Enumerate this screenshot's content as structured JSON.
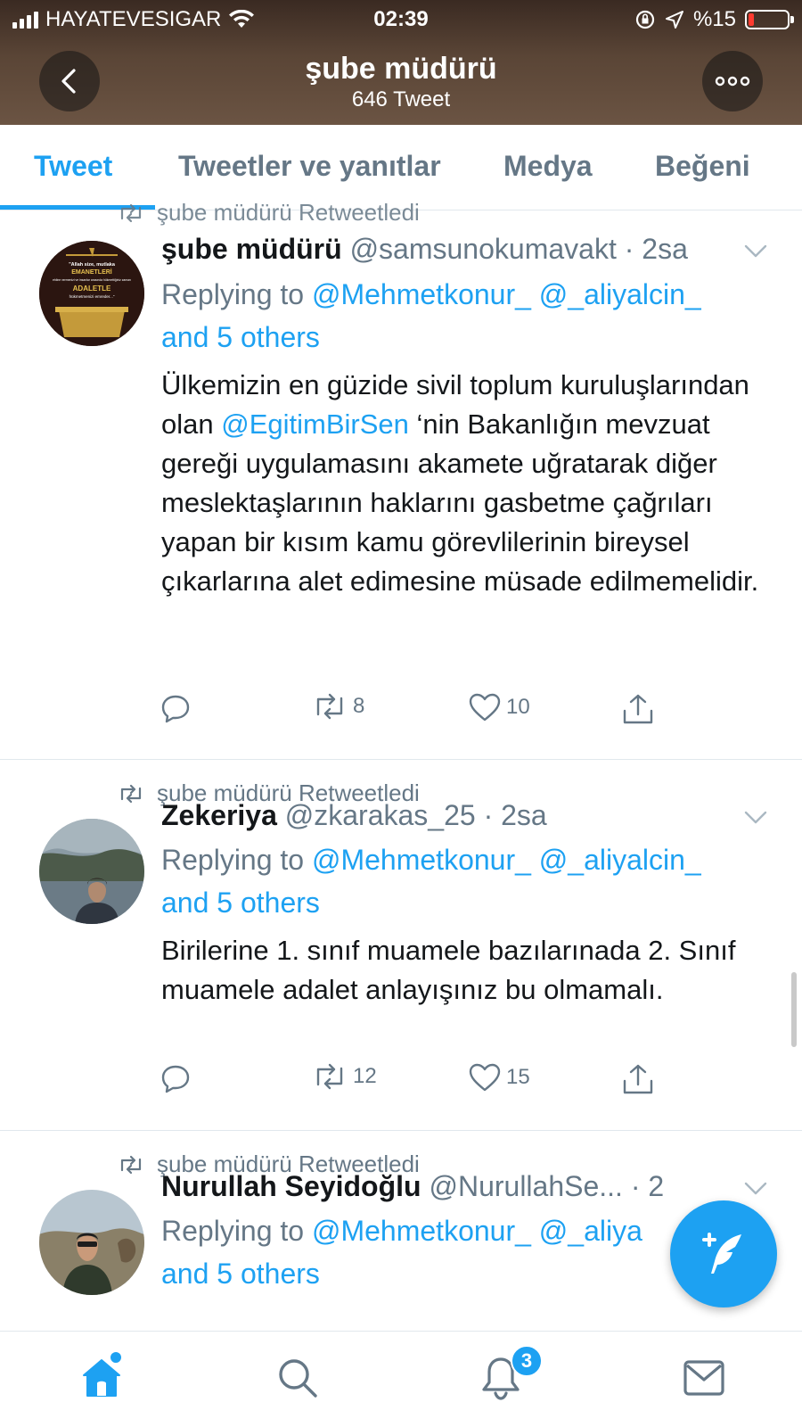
{
  "status_bar": {
    "carrier": "HAYATEVESIGAR",
    "time": "02:39",
    "battery": "%15",
    "battery_level": 0.15,
    "icons": [
      "signal-bars-icon",
      "wifi-icon",
      "orientation-lock-icon",
      "location-arrow-icon",
      "battery-icon"
    ]
  },
  "header": {
    "title": "şube müdürü",
    "subtitle": "646 Tweet",
    "back_icon": "chevron-left-icon",
    "more_icon": "more-dots-icon"
  },
  "tabs": [
    {
      "label": "Tweet",
      "active": true
    },
    {
      "label": "Tweetler ve yanıtlar",
      "active": false
    },
    {
      "label": "Medya",
      "active": false
    },
    {
      "label": "Beğeni",
      "active": false
    }
  ],
  "tweets": [
    {
      "retweet_label": "şube müdürü Retweetledi",
      "name": "şube müdürü",
      "handle": "@samsunokumavakt",
      "time": "2sa",
      "reply_prefix": "Replying to",
      "reply_mention_1": "@Mehmetkonur_",
      "reply_mention_2": "@_aliyalcin_",
      "reply_others": "and 5 others",
      "text_before": "Ülkemizin en güzide sivil toplum kuruluşlarından olan ",
      "text_mention": "@EgitimBirSen",
      "text_after": " ‘nin Bakanlığın mevzuat gereği uygulamasını akamete uğratarak diğer meslektaşlarının haklarını gasbetme çağrıları yapan bir kısım kamu görevlilerinin bireysel çıkarlarına alet edimesine müsade edilmemelidir.",
      "retweets": "8",
      "likes": "10",
      "avatar_text": {
        "line1": "\"Allah size, mutlaka",
        "line2": "EMANETLERİ",
        "line3": "ehline vermenizi ve insanlar arasında hükmettiğiniz zaman",
        "line4": "ADALETLE",
        "line5": "hükmetmenizi emreder...\""
      }
    },
    {
      "retweet_label": "şube müdürü Retweetledi",
      "name": "Zekeriya",
      "handle": "@zkarakas_25",
      "time": "2sa",
      "reply_prefix": "Replying to",
      "reply_mention_1": "@Mehmetkonur_",
      "reply_mention_2": "@_aliyalcin_",
      "reply_others": "and 5 others",
      "text": "Birilerine 1. sınıf muamele bazılarınada 2. Sınıf muamele adalet anlayışınız bu olmamalı.",
      "retweets": "12",
      "likes": "15"
    },
    {
      "retweet_label": "şube müdürü Retweetledi",
      "name": "Nurullah Seyidoğlu",
      "handle": "@NurullahSe...",
      "time": "2",
      "reply_prefix": "Replying to",
      "reply_mention_1": "@Mehmetkonur_",
      "reply_mention_2": "@_aliya",
      "reply_others": "and 5 others"
    }
  ],
  "fab": {
    "icon": "compose-tweet-icon"
  },
  "bottom_nav": {
    "items": [
      "home-icon",
      "search-icon",
      "notifications-icon",
      "messages-icon"
    ],
    "notification_count": "3"
  },
  "colors": {
    "accent": "#1da1f2",
    "text_primary": "#14171a",
    "text_secondary": "#657786",
    "header_bg": "#5a4536"
  }
}
